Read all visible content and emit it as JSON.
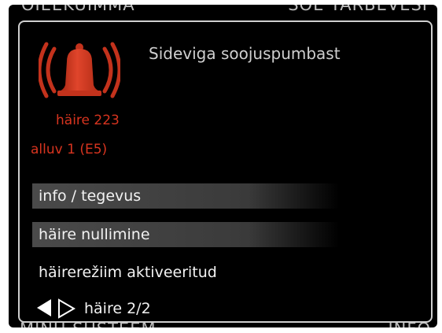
{
  "background": {
    "top_left": "OIEEKUIMMA",
    "top_right": "SOE TARBEVESI",
    "bottom_left": "MINU SÜSTEEM",
    "bottom_right": "INFO"
  },
  "alarm": {
    "icon": "alarm-bell-icon",
    "title": "Sideviga soojuspumbast",
    "code": "häire 223",
    "source": "alluv 1 (E5)",
    "color": "#d7341f"
  },
  "menu": {
    "items": [
      {
        "label": "info / tegevus",
        "selected": true
      },
      {
        "label": "häire nullimine",
        "selected": true
      },
      {
        "label": "häirerežiim aktiveeritud",
        "selected": false
      }
    ]
  },
  "pager": {
    "text": "häire 2/2"
  }
}
